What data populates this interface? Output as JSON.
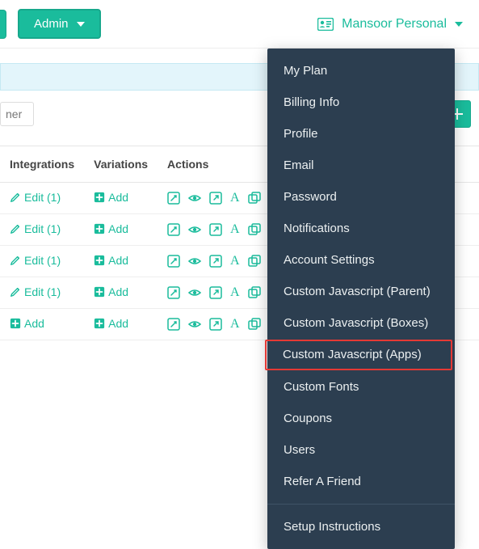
{
  "header": {
    "admin_label": "Admin",
    "user_name": "Mansoor Personal"
  },
  "subbar": {
    "ner_chip": "ner"
  },
  "table": {
    "columns": {
      "integrations": "Integrations",
      "variations": "Variations",
      "actions": "Actions"
    },
    "rows": [
      {
        "integrations": "Edit (1)",
        "variations": "Add"
      },
      {
        "integrations": "Edit (1)",
        "variations": "Add"
      },
      {
        "integrations": "Edit (1)",
        "variations": "Add"
      },
      {
        "integrations": "Edit (1)",
        "variations": "Add"
      },
      {
        "integrations": "Add",
        "variations": "Add"
      }
    ],
    "action_icons": [
      "edit",
      "eye",
      "external",
      "font",
      "boxes",
      "folder",
      "copy"
    ]
  },
  "dropdown": {
    "items": [
      "My Plan",
      "Billing Info",
      "Profile",
      "Email",
      "Password",
      "Notifications",
      "Account Settings",
      "Custom Javascript (Parent)",
      "Custom Javascript (Boxes)",
      "Custom Javascript (Apps)",
      "Custom Fonts",
      "Coupons",
      "Users",
      "Refer A Friend"
    ],
    "highlighted_index": 9,
    "footer_item": "Setup Instructions"
  },
  "colors": {
    "accent": "#1abc9c",
    "dropdown_bg": "#2c3e50",
    "highlight_border": "#e53935"
  }
}
